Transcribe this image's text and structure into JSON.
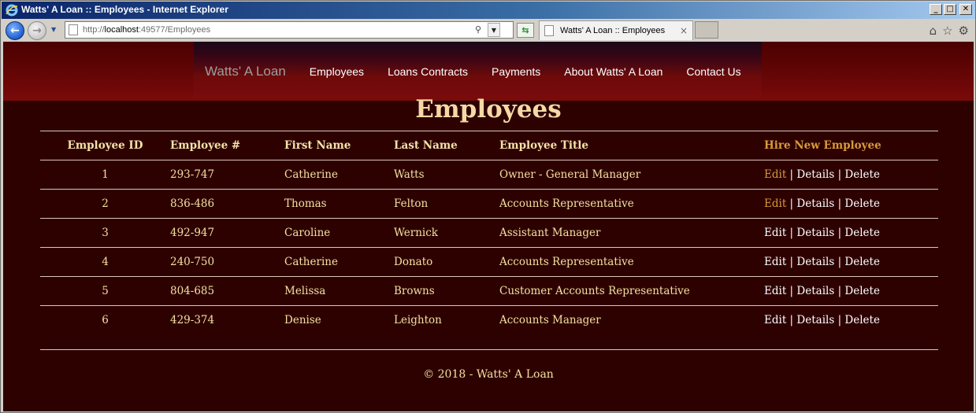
{
  "window": {
    "title": "Watts' A Loan :: Employees - Internet Explorer",
    "controls": {
      "minimize": "_",
      "maximize": "□",
      "close": "✕"
    }
  },
  "browser": {
    "url_prefix": "http://",
    "url_host": "localhost",
    "url_rest": ":49577/Employees",
    "tab_title": "Watts' A Loan :: Employees",
    "tab_close": "×"
  },
  "site": {
    "brand": "Watts' A Loan",
    "nav": [
      "Employees",
      "Loans Contracts",
      "Payments",
      "About Watts' A Loan",
      "Contact Us"
    ]
  },
  "page": {
    "title": "Employees",
    "hire_link": "Hire New Employee",
    "columns": [
      "Employee ID",
      "Employee #",
      "First Name",
      "Last Name",
      "Employee Title"
    ],
    "rows": [
      {
        "id": "1",
        "number": "293-747",
        "first": "Catherine",
        "last": "Watts",
        "title": "Owner - General Manager"
      },
      {
        "id": "2",
        "number": "836-486",
        "first": "Thomas",
        "last": "Felton",
        "title": "Accounts Representative"
      },
      {
        "id": "3",
        "number": "492-947",
        "first": "Caroline",
        "last": "Wernick",
        "title": "Assistant Manager"
      },
      {
        "id": "4",
        "number": "240-750",
        "first": "Catherine",
        "last": "Donato",
        "title": "Accounts Representative"
      },
      {
        "id": "5",
        "number": "804-685",
        "first": "Melissa",
        "last": "Browns",
        "title": "Customer Accounts Representative"
      },
      {
        "id": "6",
        "number": "429-374",
        "first": "Denise",
        "last": "Leighton",
        "title": "Accounts Manager"
      }
    ],
    "actions": {
      "edit": "Edit",
      "details": "Details",
      "delete": "Delete",
      "separator": "|"
    }
  },
  "footer": {
    "text": "© 2018 - Watts' A Loan"
  },
  "colors": {
    "page_bg": "#2e0101",
    "header_red": "#7a0a0a",
    "gold_text": "#f2e0a0",
    "title_text": "#f4d9a6",
    "link_orange": "#d99a3a"
  }
}
